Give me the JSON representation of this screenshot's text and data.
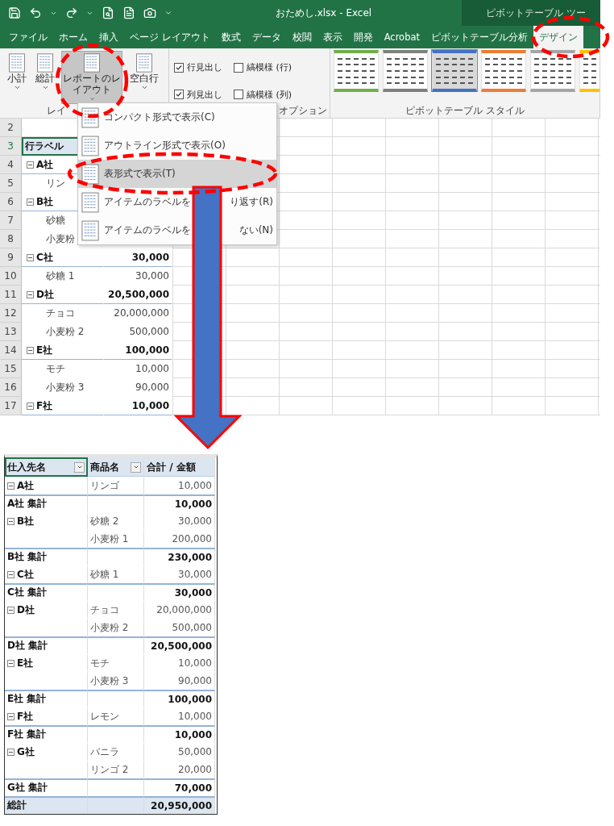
{
  "window": {
    "title": "おためし.xlsx  -  Excel",
    "context_title": "ピボットテーブル ツー"
  },
  "tabs": [
    {
      "label": "ファイル",
      "selected": false
    },
    {
      "label": "ホーム",
      "selected": false
    },
    {
      "label": "挿入",
      "selected": false
    },
    {
      "label": "ページ レイアウト",
      "selected": false
    },
    {
      "label": "数式",
      "selected": false
    },
    {
      "label": "データ",
      "selected": false
    },
    {
      "label": "校閲",
      "selected": false
    },
    {
      "label": "表示",
      "selected": false
    },
    {
      "label": "開発",
      "selected": false
    },
    {
      "label": "Acrobat",
      "selected": false
    },
    {
      "label": "ピボットテーブル分析",
      "selected": false
    },
    {
      "label": "デザイン",
      "selected": true
    }
  ],
  "ribbon": {
    "layout_group": {
      "label": "レイ",
      "buttons": [
        {
          "lines": [
            "小計"
          ],
          "pressed": false
        },
        {
          "lines": [
            "総計"
          ],
          "pressed": false
        },
        {
          "lines": [
            "レポートのレ",
            "イアウト"
          ],
          "pressed": true
        },
        {
          "lines": [
            "空白行"
          ],
          "pressed": false
        }
      ]
    },
    "options_group": {
      "label": "オプション",
      "checkboxes": [
        {
          "label": "行見出し",
          "checked": true
        },
        {
          "label": "縞模様 (行)",
          "checked": false
        },
        {
          "label": "列見出し",
          "checked": true
        },
        {
          "label": "縞模様 (列)",
          "checked": false
        }
      ]
    },
    "styles_group": {
      "label": "ピボットテーブル スタイル",
      "styles": [
        {
          "color": "#70ad47",
          "selected": false
        },
        {
          "color": "#7f7f7f",
          "selected": false
        },
        {
          "color": "#4472c4",
          "selected": true
        },
        {
          "color": "#ed7d31",
          "selected": false
        },
        {
          "color": "#a5a5a5",
          "selected": false
        },
        {
          "color": "#ffc000",
          "selected": false
        }
      ]
    }
  },
  "layout_menu": {
    "items": [
      {
        "label": "コンパクト形式で表示(C)",
        "selected": false
      },
      {
        "label": "アウトライン形式で表示(O)",
        "selected": false
      },
      {
        "label": "表形式で表示(T)",
        "selected": true
      },
      {
        "label": "アイテムのラベルを",
        "label_end": "り返す(R)",
        "selected": false
      },
      {
        "label": "アイテムのラベルを",
        "label_end": "ない(N)",
        "selected": false
      }
    ]
  },
  "sheet": {
    "rows": [
      {
        "number": "2",
        "kind": "blank"
      },
      {
        "number": "3",
        "kind": "header",
        "label": "行ラベル"
      },
      {
        "number": "4",
        "kind": "group",
        "label": "A社"
      },
      {
        "number": "5",
        "kind": "item",
        "label": "リン"
      },
      {
        "number": "6",
        "kind": "group",
        "label": "B社"
      },
      {
        "number": "7",
        "kind": "item",
        "label": "砂糖"
      },
      {
        "number": "8",
        "kind": "item",
        "label": "小麦粉"
      },
      {
        "number": "9",
        "kind": "group",
        "label": "C社",
        "value": "30,000"
      },
      {
        "number": "10",
        "kind": "item",
        "label": "砂糖 1",
        "value": "30,000"
      },
      {
        "number": "11",
        "kind": "group",
        "label": "D社",
        "value": "20,500,000"
      },
      {
        "number": "12",
        "kind": "item",
        "label": "チョコ",
        "value": "20,000,000"
      },
      {
        "number": "13",
        "kind": "item",
        "label": "小麦粉 2",
        "value": "500,000"
      },
      {
        "number": "14",
        "kind": "group",
        "label": "E社",
        "value": "100,000"
      },
      {
        "number": "15",
        "kind": "item",
        "label": "モチ",
        "value": "10,000"
      },
      {
        "number": "16",
        "kind": "item",
        "label": "小麦粉 3",
        "value": "90,000"
      },
      {
        "number": "17",
        "kind": "group",
        "label": "F社",
        "value": "10,000"
      }
    ]
  },
  "result_table": {
    "columns": [
      {
        "label": "仕入先名",
        "filter": true,
        "selected": true
      },
      {
        "label": "商品名",
        "filter": true,
        "selected": false
      },
      {
        "label": "合計 / 金額",
        "filter": false,
        "selected": false
      }
    ],
    "rows": [
      {
        "kind": "group",
        "supplier": "A社",
        "product": "リンゴ",
        "amount": "10,000"
      },
      {
        "kind": "subtotal",
        "supplier": "A社 集計",
        "amount": "10,000"
      },
      {
        "kind": "group",
        "supplier": "B社",
        "product": "砂糖 2",
        "amount": "30,000"
      },
      {
        "kind": "item",
        "product": "小麦粉 1",
        "amount": "200,000"
      },
      {
        "kind": "subtotal",
        "supplier": "B社 集計",
        "amount": "230,000"
      },
      {
        "kind": "group",
        "supplier": "C社",
        "product": "砂糖 1",
        "amount": "30,000"
      },
      {
        "kind": "subtotal",
        "supplier": "C社 集計",
        "amount": "30,000"
      },
      {
        "kind": "group",
        "supplier": "D社",
        "product": "チョコ",
        "amount": "20,000,000"
      },
      {
        "kind": "item",
        "product": "小麦粉 2",
        "amount": "500,000"
      },
      {
        "kind": "subtotal",
        "supplier": "D社 集計",
        "amount": "20,500,000"
      },
      {
        "kind": "group",
        "supplier": "E社",
        "product": "モチ",
        "amount": "10,000"
      },
      {
        "kind": "item",
        "product": "小麦粉 3",
        "amount": "90,000"
      },
      {
        "kind": "subtotal",
        "supplier": "E社 集計",
        "amount": "100,000"
      },
      {
        "kind": "group",
        "supplier": "F社",
        "product": "レモン",
        "amount": "10,000"
      },
      {
        "kind": "subtotal",
        "supplier": "F社 集計",
        "amount": "10,000"
      },
      {
        "kind": "group",
        "supplier": "G社",
        "product": "バニラ",
        "amount": "50,000"
      },
      {
        "kind": "item",
        "product": "リンゴ 2",
        "amount": "20,000"
      },
      {
        "kind": "subtotal",
        "supplier": "G社 集計",
        "amount": "70,000"
      },
      {
        "kind": "total",
        "supplier": "総計",
        "amount": "20,950,000"
      }
    ]
  }
}
